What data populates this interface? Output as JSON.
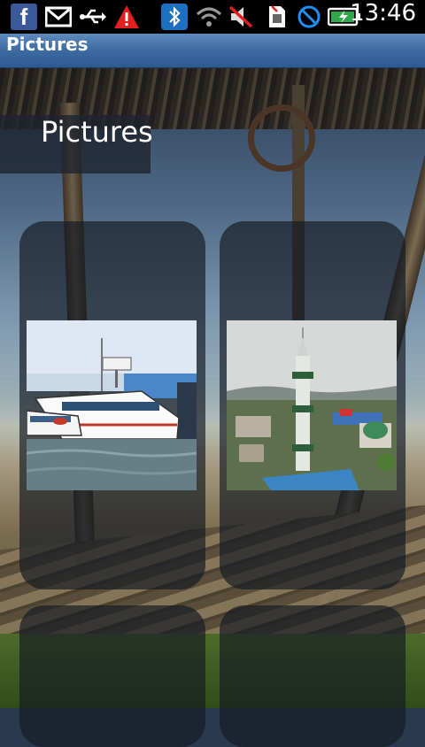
{
  "status_bar": {
    "icons": [
      "facebook-icon",
      "gmail-icon",
      "usb-icon",
      "warning-icon",
      "bluetooth-icon",
      "wifi-icon",
      "mute-icon",
      "sim-icon",
      "no-signal-icon",
      "battery-charging-icon"
    ],
    "time": "13:46"
  },
  "title_bar": {
    "title": "Pictures"
  },
  "header": {
    "title": "Pictures"
  },
  "gallery": {
    "items": [
      {
        "name": "ferry-photo"
      },
      {
        "name": "mosque-photo"
      },
      {
        "name": "empty-tile"
      },
      {
        "name": "empty-tile"
      }
    ]
  }
}
